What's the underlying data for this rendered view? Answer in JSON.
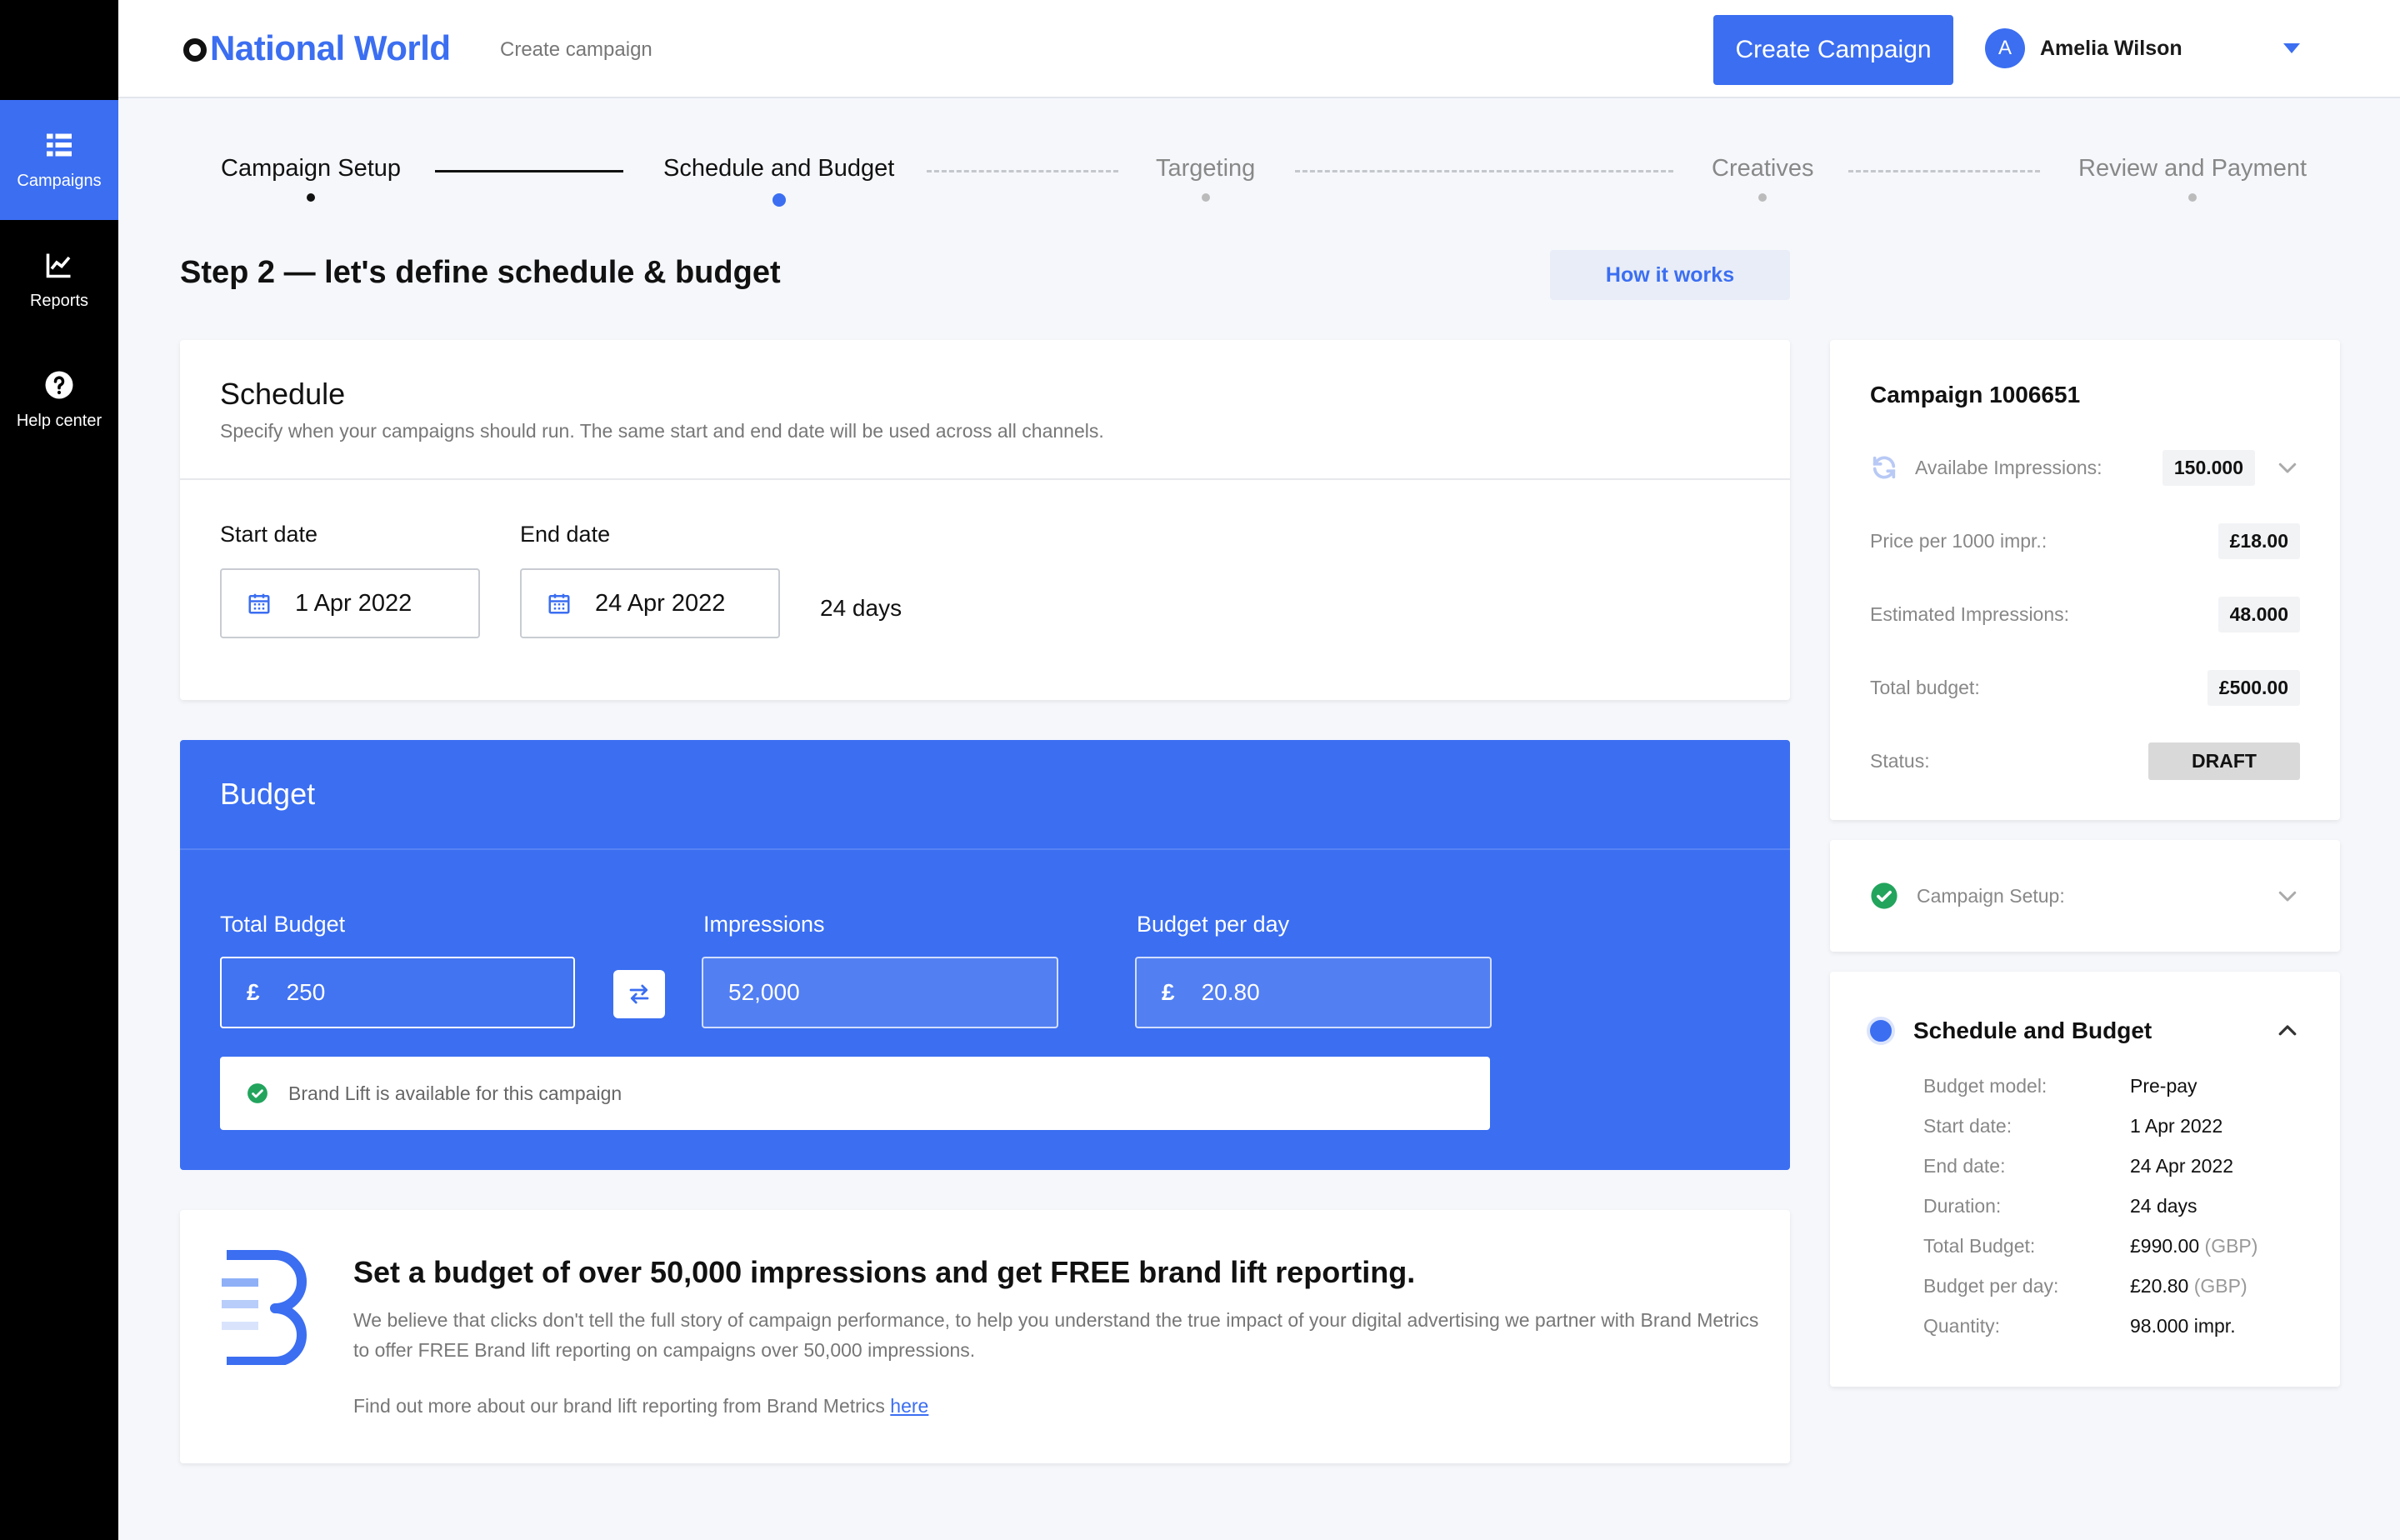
{
  "sidebar": {
    "items": [
      {
        "label": "Campaigns",
        "icon": "campaigns-grid-icon"
      },
      {
        "label": "Reports",
        "icon": "chart-line-icon"
      },
      {
        "label": "Help center",
        "icon": "help-circle-icon"
      }
    ]
  },
  "header": {
    "logo": "National World",
    "breadcrumb": "Create campaign",
    "create_button": "Create Campaign",
    "user": {
      "initial": "A",
      "name": "Amelia Wilson"
    }
  },
  "stepper": {
    "steps": [
      {
        "label": "Campaign Setup",
        "state": "done"
      },
      {
        "label": "Schedule and Budget",
        "state": "active"
      },
      {
        "label": "Targeting",
        "state": "todo"
      },
      {
        "label": "Creatives",
        "state": "todo"
      },
      {
        "label": "Review and Payment",
        "state": "todo"
      }
    ]
  },
  "page": {
    "title": "Step 2 — let's define schedule & budget",
    "how_it_works": "How it works"
  },
  "schedule": {
    "title": "Schedule",
    "subtitle": "Specify when your campaigns should run. The same start and end date will be used across all channels.",
    "start_label": "Start date",
    "start_value": "1 Apr 2022",
    "end_label": "End date",
    "end_value": "24 Apr 2022",
    "duration": "24 days"
  },
  "budget": {
    "title": "Budget",
    "total_label": "Total Budget",
    "currency": "£",
    "total_value": "250",
    "impressions_label": "Impressions",
    "impressions_value": "52,000",
    "per_day_label": "Budget per day",
    "per_day_value": "20.80",
    "brand_lift": "Brand Lift is available for this campaign"
  },
  "promo": {
    "title": "Set a budget of over 50,000 impressions and get FREE brand lift reporting.",
    "text": "We believe that clicks don't tell the full story of campaign performance, to help you understand the true impact of your digital advertising we partner with Brand Metrics to offer FREE Brand lift reporting on campaigns over 50,000 impressions.",
    "more_text": "Find out more about our brand lift reporting from Brand Metrics ",
    "more_link": "here"
  },
  "summary": {
    "title": "Campaign 1006651",
    "rows": [
      {
        "label": "Availabe Impressions:",
        "value": "150.000"
      },
      {
        "label": "Price per 1000 impr.:",
        "value": "£18.00"
      },
      {
        "label": "Estimated Impressions:",
        "value": "48.000"
      },
      {
        "label": "Total budget:",
        "value": "£500.00"
      },
      {
        "label": "Status:",
        "value": "DRAFT"
      }
    ]
  },
  "setup_panel": {
    "label": "Campaign Setup:"
  },
  "detail_panel": {
    "title": "Schedule and Budget",
    "rows": [
      {
        "label": "Budget model:",
        "value": "Pre-pay",
        "unit": ""
      },
      {
        "label": "Start date:",
        "value": "1 Apr 2022",
        "unit": ""
      },
      {
        "label": "End date:",
        "value": "24 Apr 2022",
        "unit": ""
      },
      {
        "label": "Duration:",
        "value": "24 days",
        "unit": ""
      },
      {
        "label": "Total Budget:",
        "value": "£990.00",
        "unit": "(GBP)"
      },
      {
        "label": "Budget per day:",
        "value": "£20.80",
        "unit": "(GBP)"
      },
      {
        "label": "Quantity:",
        "value": "98.000 impr.",
        "unit": ""
      }
    ]
  },
  "colors": {
    "accent": "#3b6ef1",
    "sidebar": "#000000",
    "success": "#22a45d",
    "draft_badge": "#d9d9d9"
  }
}
